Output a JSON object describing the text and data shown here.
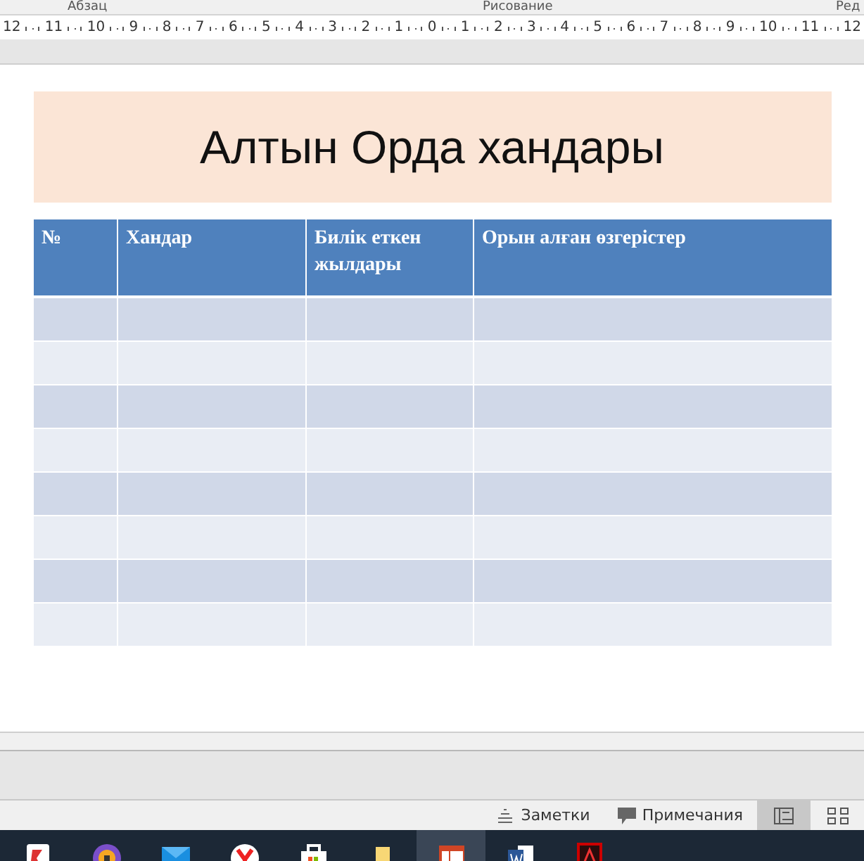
{
  "ribbon_groups": [
    {
      "label": "Абзац"
    },
    {
      "label": "Рисование"
    },
    {
      "label": "Ред"
    }
  ],
  "ruler": {
    "labels": [
      "12",
      "11",
      "10",
      "9",
      "8",
      "7",
      "6",
      "5",
      "4",
      "3",
      "2",
      "1",
      "0",
      "1",
      "2",
      "3",
      "4",
      "5",
      "6",
      "7",
      "8",
      "9",
      "10",
      "11",
      "12"
    ]
  },
  "slide": {
    "title": "Алтын Орда хандары",
    "table": {
      "columns": [
        "№",
        "Хандар",
        "Билік еткен жылдары",
        "Орын алған өзгерістер"
      ],
      "rows": [
        {
          "banded": true
        },
        {
          "banded": false
        },
        {
          "banded": true
        },
        {
          "banded": false
        },
        {
          "banded": true
        },
        {
          "banded": false
        },
        {
          "banded": true
        },
        {
          "banded": false
        }
      ]
    }
  },
  "status_bar": {
    "notes": "Заметки",
    "comments": "Примечания",
    "views": [
      {
        "selected": true
      },
      {
        "selected": false
      }
    ]
  },
  "taskbar": [
    {
      "selected": false
    },
    {
      "selected": false
    },
    {
      "selected": false
    },
    {
      "selected": false
    },
    {
      "selected": false
    },
    {
      "selected": false
    },
    {
      "selected": true
    },
    {
      "selected": false
    },
    {
      "selected": false
    }
  ]
}
